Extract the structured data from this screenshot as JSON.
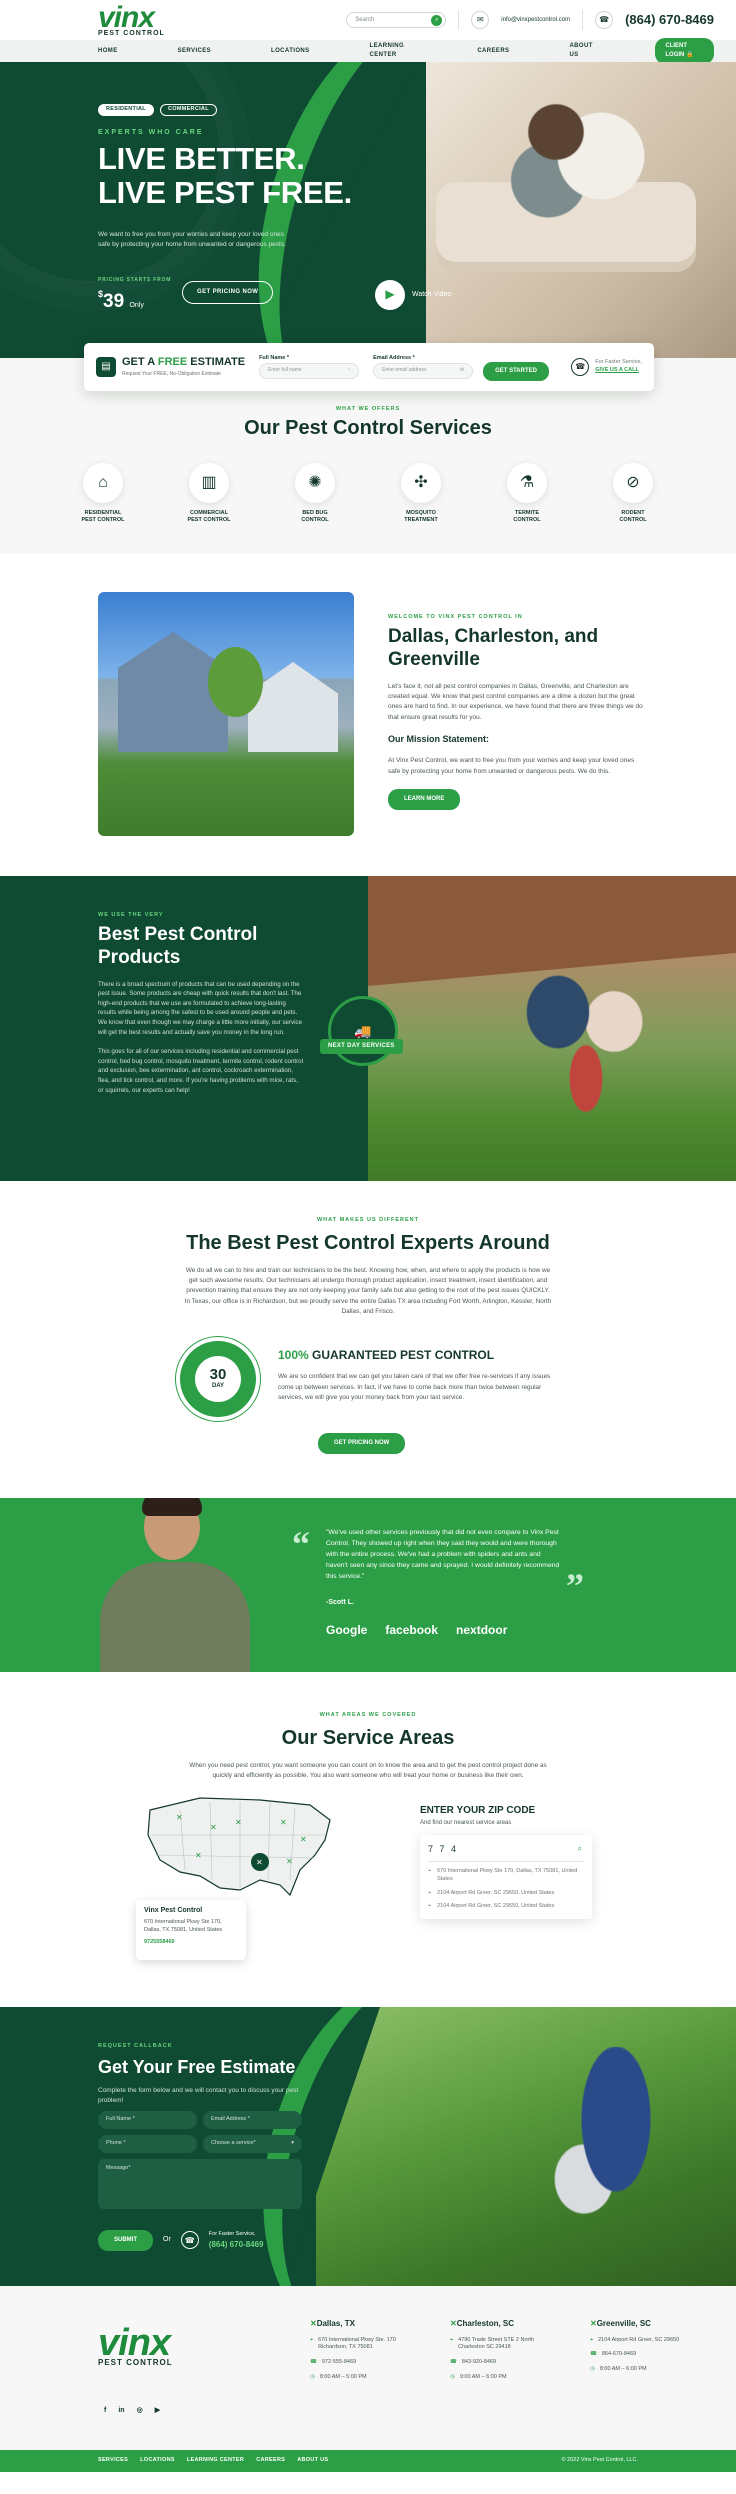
{
  "brand": {
    "logo_main": "vinx",
    "logo_sub": "PEST CONTROL"
  },
  "topbar": {
    "search_placeholder": "Search",
    "email": "info@vinxpestcontrol.com",
    "phone": "(864) 670-8469"
  },
  "nav": {
    "items": [
      "HOME",
      "SERVICES",
      "LOCATIONS",
      "LEARNING CENTER",
      "CAREERS",
      "ABOUT US"
    ],
    "login": "CLIENT LOGIN"
  },
  "hero": {
    "pill_residential": "RESIDENTIAL",
    "pill_commercial": "COMMERCIAL",
    "kicker": "EXPERTS WHO CARE",
    "title_1": "LIVE BETTER.",
    "title_2": "LIVE PEST FREE.",
    "desc": "We want to free you from your worries and keep your loved ones safe by protecting your home from unwanted or dangerous pests.",
    "pricing_label": "PRICING STARTS FROM",
    "price_currency": "$",
    "price": "39",
    "price_suffix": "Only",
    "cta": "GET PRICING NOW",
    "watch": "Watch Video"
  },
  "estimate": {
    "title_pre": "GET A",
    "title_free": "FREE",
    "title_post": "ESTIMATE",
    "subtitle": "Request Your FREE, No-Obligation Estimate",
    "name_label": "Full Name *",
    "name_placeholder": "Enter full name",
    "address_label": "Email Address *",
    "address_placeholder": "Enter email address",
    "button": "GET STARTED",
    "call_1": "For Faster Service,",
    "call_2": "GIVE US A CALL"
  },
  "services": {
    "eyebrow": "WHAT WE OFFERS",
    "title": "Our Pest Control Services",
    "items": [
      {
        "label": "RESIDENTIAL PEST CONTROL",
        "icon": "house-icon",
        "glyph": "⌂"
      },
      {
        "label": "COMMERCIAL PEST CONTROL",
        "icon": "building-icon",
        "glyph": "▥"
      },
      {
        "label": "BED BUG CONTROL",
        "icon": "bedbug-icon",
        "glyph": "✺"
      },
      {
        "label": "MOSQUITO TREATMENT",
        "icon": "mosquito-icon",
        "glyph": "✣"
      },
      {
        "label": "TERMITE CONTROL",
        "icon": "sprayer-icon",
        "glyph": "⚗"
      },
      {
        "label": "RODENT CONTROL",
        "icon": "rodent-icon",
        "glyph": "⊘"
      }
    ]
  },
  "welcome": {
    "eyebrow": "WELCOME TO VINX PEST CONTROL IN",
    "title": "Dallas, Charleston, and Greenville",
    "p1": "Let's face it, not all pest control companies in Dallas, Greenville, and Charleston are created equal. We know that pest control companies are a dime a dozen but the great ones are hard to find. In our experience, we have found that there are three things we do that ensure great results for you.",
    "mission_title": "Our Mission Statement:",
    "p2": "At Vinx Pest Control, we want to free you from your worries and keep your loved ones safe by protecting your home from unwanted or dangerous pests. We do this.",
    "button": "LEARN MORE"
  },
  "best": {
    "eyebrow": "WE USE THE VERY",
    "title": "Best Pest Control Products",
    "p1": "There is a broad spectrum of products that can be used depending on the pest issue. Some products are cheap with quick results that don't last. The high-end products that we use are formulated to achieve long-lasting results while being among the safest to be used around people and pets. We know that even though we may charge a little more initially, our service will get the best results and actually save you money in the long run.",
    "p2": "This goes for all of our services including residential and commercial pest control, bed bug control, mosquito treatment, termite control, rodent control and exclusion, bee extermination, ant control, cockroach extermination, flea, and tick control, and more. If you're having problems with mice, rats, or squirrels, our experts can help!",
    "badge": "NEXT DAY SERVICES"
  },
  "experts": {
    "eyebrow": "WHAT MAKES US DIFFERENT",
    "title": "The Best Pest Control Experts Around",
    "intro": "We do all we can to hire and train our technicians to be the best. Knowing how, when, and where to apply the products is how we get such awesome results. Our technicians all undergo thorough product application, insect treatment, insect identification, and prevention training that ensure they are not only keeping your family safe but also getting to the root of the pest issues QUICKLY. In Texas, our office is in Richardson, but we proudly serve the entire Dallas TX area including Fort Worth, Arlington, Kessler, North Dallas, and Frisco.",
    "seal_number": "30",
    "seal_unit": "DAY",
    "guarantee_pct": "100%",
    "guarantee_title": "GUARANTEED PEST CONTROL",
    "guarantee_text": "We are so confident that we can get you taken care of that we offer free re-services if any issues come up between services. In fact, if we have to come back more than twice between regular services, we will give you your money back from your last service.",
    "button": "GET PRICING NOW"
  },
  "testimonial": {
    "quote": "\"We've used other services previously that did not even compare to Vinx Pest Control. They showed up right when they said they would and were thorough with the entire process. We've had a problem with spiders and ants and haven't seen any since they came and sprayed. I would definitely recommend this service.\"",
    "name": "-Scott L.",
    "brands": [
      "Google",
      "facebook",
      "nextdoor"
    ]
  },
  "areas": {
    "eyebrow": "WHAT AREAS WE COVERED",
    "title": "Our Service Areas",
    "intro": "When you need pest control, you want someone you can count on to know the area and to get the pest control project done as quickly and efficiently as possible. You also want someone who will treat your home or business like their own.",
    "loc_title": "Vinx Pest Control",
    "loc_address": "670 International Pkwy Ste 170, Dallas, TX 75081, United States",
    "loc_phone": "9725558469",
    "zip_title": "ENTER YOUR ZIP CODE",
    "zip_sub": "And find our nearest service areas",
    "zip_value": "7 7 4",
    "results": [
      "670 International Pkwy Ste 170, Dallas, TX 75081, United States",
      "2104 Airport Rd Greer, SC 29650, United States",
      "2104 Airport Rd Greer, SC 29650, United States"
    ]
  },
  "get_estimate": {
    "eyebrow": "REQUEST CALLBACK",
    "title": "Get Your Free Estimate",
    "desc": "Complete the form below and we will contact you to discuss your pest problem!",
    "full_name": "Full Name *",
    "email": "Email Address *",
    "phone": "Phone *",
    "service": "Choose a service*",
    "message": "Message*",
    "submit": "SUBMIT",
    "or": "Or",
    "call_1": "For Faster Service,",
    "call_2": "(864) 670-8469"
  },
  "footer": {
    "social": [
      "f",
      "in",
      "◎",
      "▶"
    ],
    "cols": [
      {
        "city": "Dallas, TX",
        "address": "670 International Pkwy Ste. 170 Richardson, TX 75081",
        "phone": "972-555-8469",
        "hours": "8:00 AM – 5:00 PM"
      },
      {
        "city": "Charleston, SC",
        "address": "4790 Trade Street STE 2 North Charleston SC 29418",
        "phone": "843-920-8469",
        "hours": "9:00 AM – 6:00 PM"
      },
      {
        "city": "Greenville, SC",
        "address": "2104 Airport Rd Greer, SC 29650",
        "phone": "864-670-8469",
        "hours": "8:00 AM – 6:00 PM"
      }
    ],
    "links": [
      "SERVICES",
      "LOCATIONS",
      "LEARNING CENTER",
      "CAREERS",
      "ABOUT US"
    ],
    "copyright": "© 2022 Vinx Pest Control, LLC."
  },
  "colors": {
    "primary_green": "#2b9e46",
    "dark_green": "#0f4a33",
    "navy_text": "#14372a"
  }
}
